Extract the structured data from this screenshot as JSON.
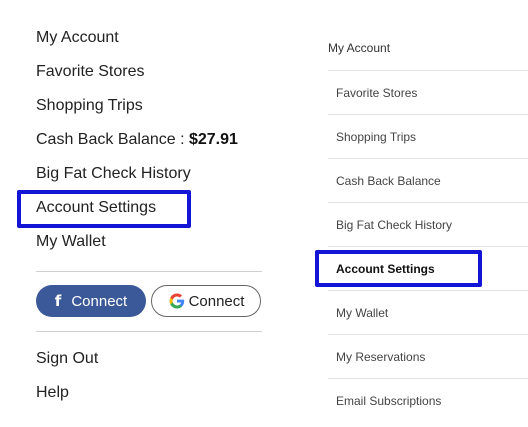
{
  "left_menu": {
    "items": [
      {
        "label": "My Account"
      },
      {
        "label": "Favorite Stores"
      },
      {
        "label": "Shopping Trips"
      },
      {
        "label": "Cash Back Balance : ",
        "value": "$27.91"
      },
      {
        "label": "Big Fat Check History"
      },
      {
        "label": "Account Settings",
        "highlighted": true
      },
      {
        "label": "My Wallet"
      }
    ],
    "facebook_button": {
      "icon": "facebook-icon",
      "label": "Connect",
      "color": "#3b5998"
    },
    "google_button": {
      "icon": "google-icon",
      "label": "Connect"
    },
    "bottom_items": [
      {
        "label": "Sign Out"
      },
      {
        "label": "Help"
      }
    ]
  },
  "right_menu": {
    "title": "My Account",
    "items": [
      {
        "label": "Favorite Stores"
      },
      {
        "label": "Shopping Trips"
      },
      {
        "label": "Cash Back Balance"
      },
      {
        "label": "Big Fat Check History"
      },
      {
        "label": "Account Settings",
        "active": true
      },
      {
        "label": "My Wallet"
      },
      {
        "label": "My Reservations"
      },
      {
        "label": "Email Subscriptions"
      }
    ]
  },
  "highlight_color": "#1414d6"
}
